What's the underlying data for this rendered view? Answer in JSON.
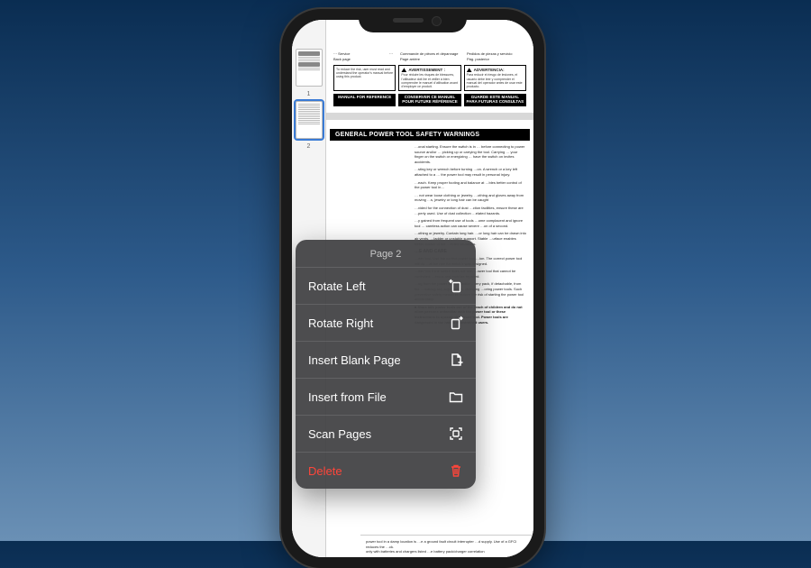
{
  "document": {
    "toc": [
      {
        "label_fr": "Commande de pièces et dépannage",
        "label_es": "Pedidos de piezas y servicio"
      },
      {
        "label_fr": "Back page",
        "label_es": ""
      },
      {
        "label_fr": "Page arrière",
        "label_es": "Pág. posterior"
      }
    ],
    "fr_box": {
      "heading": "AVERTISSEMENT :",
      "body": "Pour réduire les risques de blessures, l'utilisateur doit lire et veiller à bien comprendre le manuel d'utilisation avant d'employer ce produit.",
      "bar": "CONSERVER CE MANUEL POUR FUTURE RÉFÉRENCE"
    },
    "es_box": {
      "heading": "ADVERTENCIA:",
      "body": "Para reducir el riesgo de lesiones, el usuario debe leer y comprender el manual del operador antes de usar este producto.",
      "bar": "GUARDE ESTE MANUAL PARA FUTURAS CONSULTAS"
    },
    "en_box": {
      "body": "To reduce the risk, user must read and understand the operator's manual before using this product.",
      "bar": "MANUAL FOR REFERENCE"
    },
    "section_title": "GENERAL POWER TOOL SAFETY WARNINGS",
    "body_snips": {
      "p1": "…onal starting. Ensure the switch is in … before connecting to power source and/or … picking up or carrying the tool. Carrying … your finger on the switch or energizing … have the switch on invites accidents.",
      "p2": "…sting key or wrench before turning …on. A wrench or a key left attached to a … the power tool may result in personal injury.",
      "p3": "…each. Keep proper footing and balance at …bles better control of the power tool in…",
      "p4": "… not wear loose clothing or jewelry. …othing and gloves away from moving …s, jewelry or long hair can be caught",
      "p5": "…vided for the connection of dust …ction facilities, ensure these are …perly used. Use of dust collection …elated hazards.",
      "p6": "…y gained from frequent use of tools …ome complacent and ignore tool … careless action can cause severe …on of a second.",
      "p7": "…othing or jewelry. Contain long hair. …or long hair can be drawn into air vents. …ladder or unstable support. Stable …urface enables better control of the …ected situations.",
      "care_head": "…E AND CARE",
      "p8": "…wer tool. Use the correct power tool …ion. The correct power tool will do …at the rate for which it was designed.",
      "p9": "…wer tool if the switch does not turn …ower tool that cannot be controlled …erous and must be repaired.",
      "p10": "…ug from the power source and/or …tery pack, if detachable, from the …making any adjustments, changing …oring power tools. Such preventive safety measures reduce the risk of starting the power tool accidentally.",
      "p11": "Store idle power tools out of the reach of children and do not allow persons unfamiliar with the power tool or these instructions to operate the power tool. Power tools are dangerous in the hands of untrained users."
    },
    "bottom": {
      "l1": "power tool in a damp location is …e a ground fault circuit interrupter …d supply. Use of a GFCI reduces the …ck.",
      "l2": "only with batteries and chargers listed …e battery pack/charger correlation"
    }
  },
  "thumbnails": {
    "page1_num": "1",
    "page2_num": "2"
  },
  "context_menu": {
    "title": "Page 2",
    "rotate_left": "Rotate Left",
    "rotate_right": "Rotate Right",
    "insert_blank": "Insert Blank Page",
    "insert_file": "Insert from File",
    "scan_pages": "Scan Pages",
    "delete": "Delete"
  }
}
